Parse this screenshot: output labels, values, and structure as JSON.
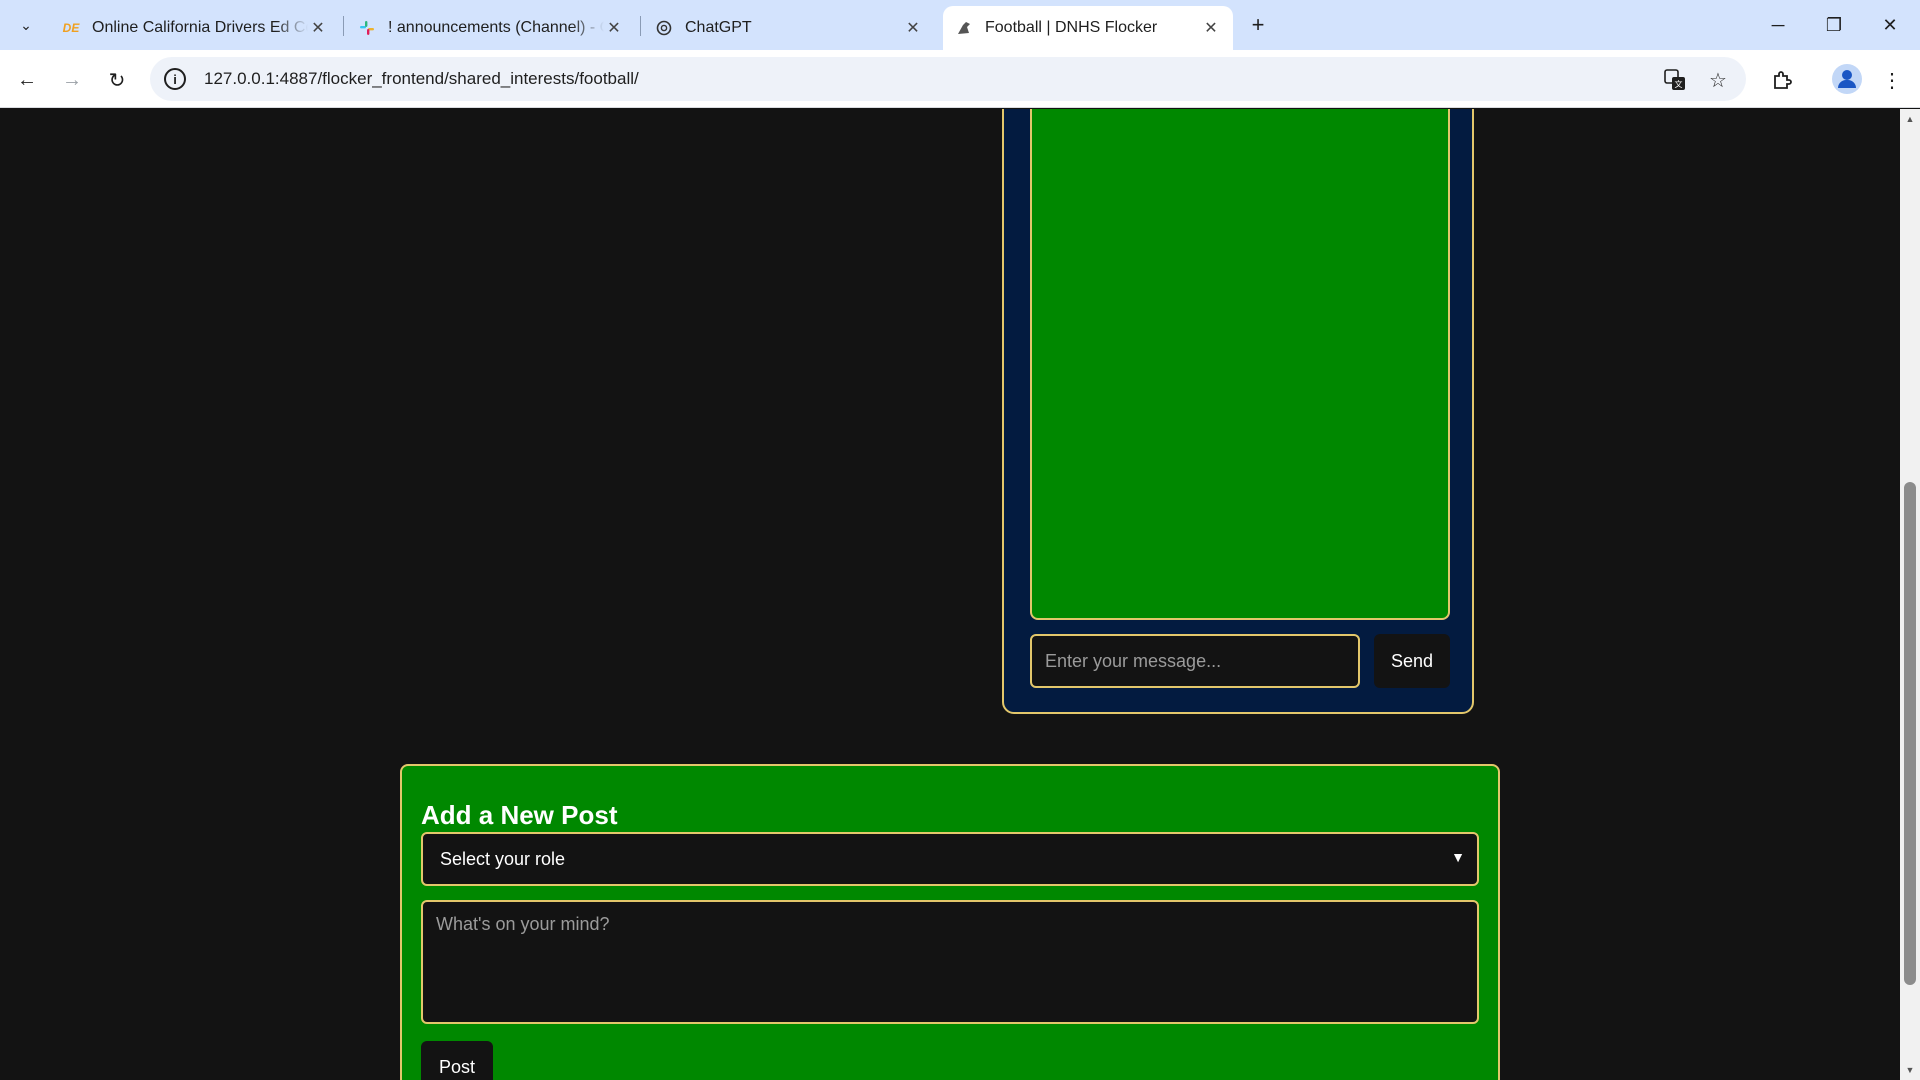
{
  "browser": {
    "tabs": [
      {
        "title": "Online California Drivers Ed Course",
        "favicon": "DE",
        "active": false
      },
      {
        "title": "! announcements (Channel) - Code",
        "favicon": "slack-icon",
        "active": false
      },
      {
        "title": "ChatGPT",
        "favicon": "chatgpt-icon",
        "active": false
      },
      {
        "title": "Football | DNHS Flocker",
        "favicon": "flocker-icon",
        "active": true
      }
    ],
    "url": "127.0.0.1:4887/flocker_frontend/shared_interests/football/"
  },
  "chat": {
    "input_placeholder": "Enter your message...",
    "send_label": "Send"
  },
  "new_post": {
    "title": "Add a New Post",
    "role_select_value": "Select your role",
    "text_placeholder": "What's on your mind?",
    "post_label": "Post"
  },
  "colors": {
    "page_bg": "#131313",
    "panel_green": "#008800",
    "chat_navy": "#031b40",
    "border_gold": "#e3c76b"
  }
}
